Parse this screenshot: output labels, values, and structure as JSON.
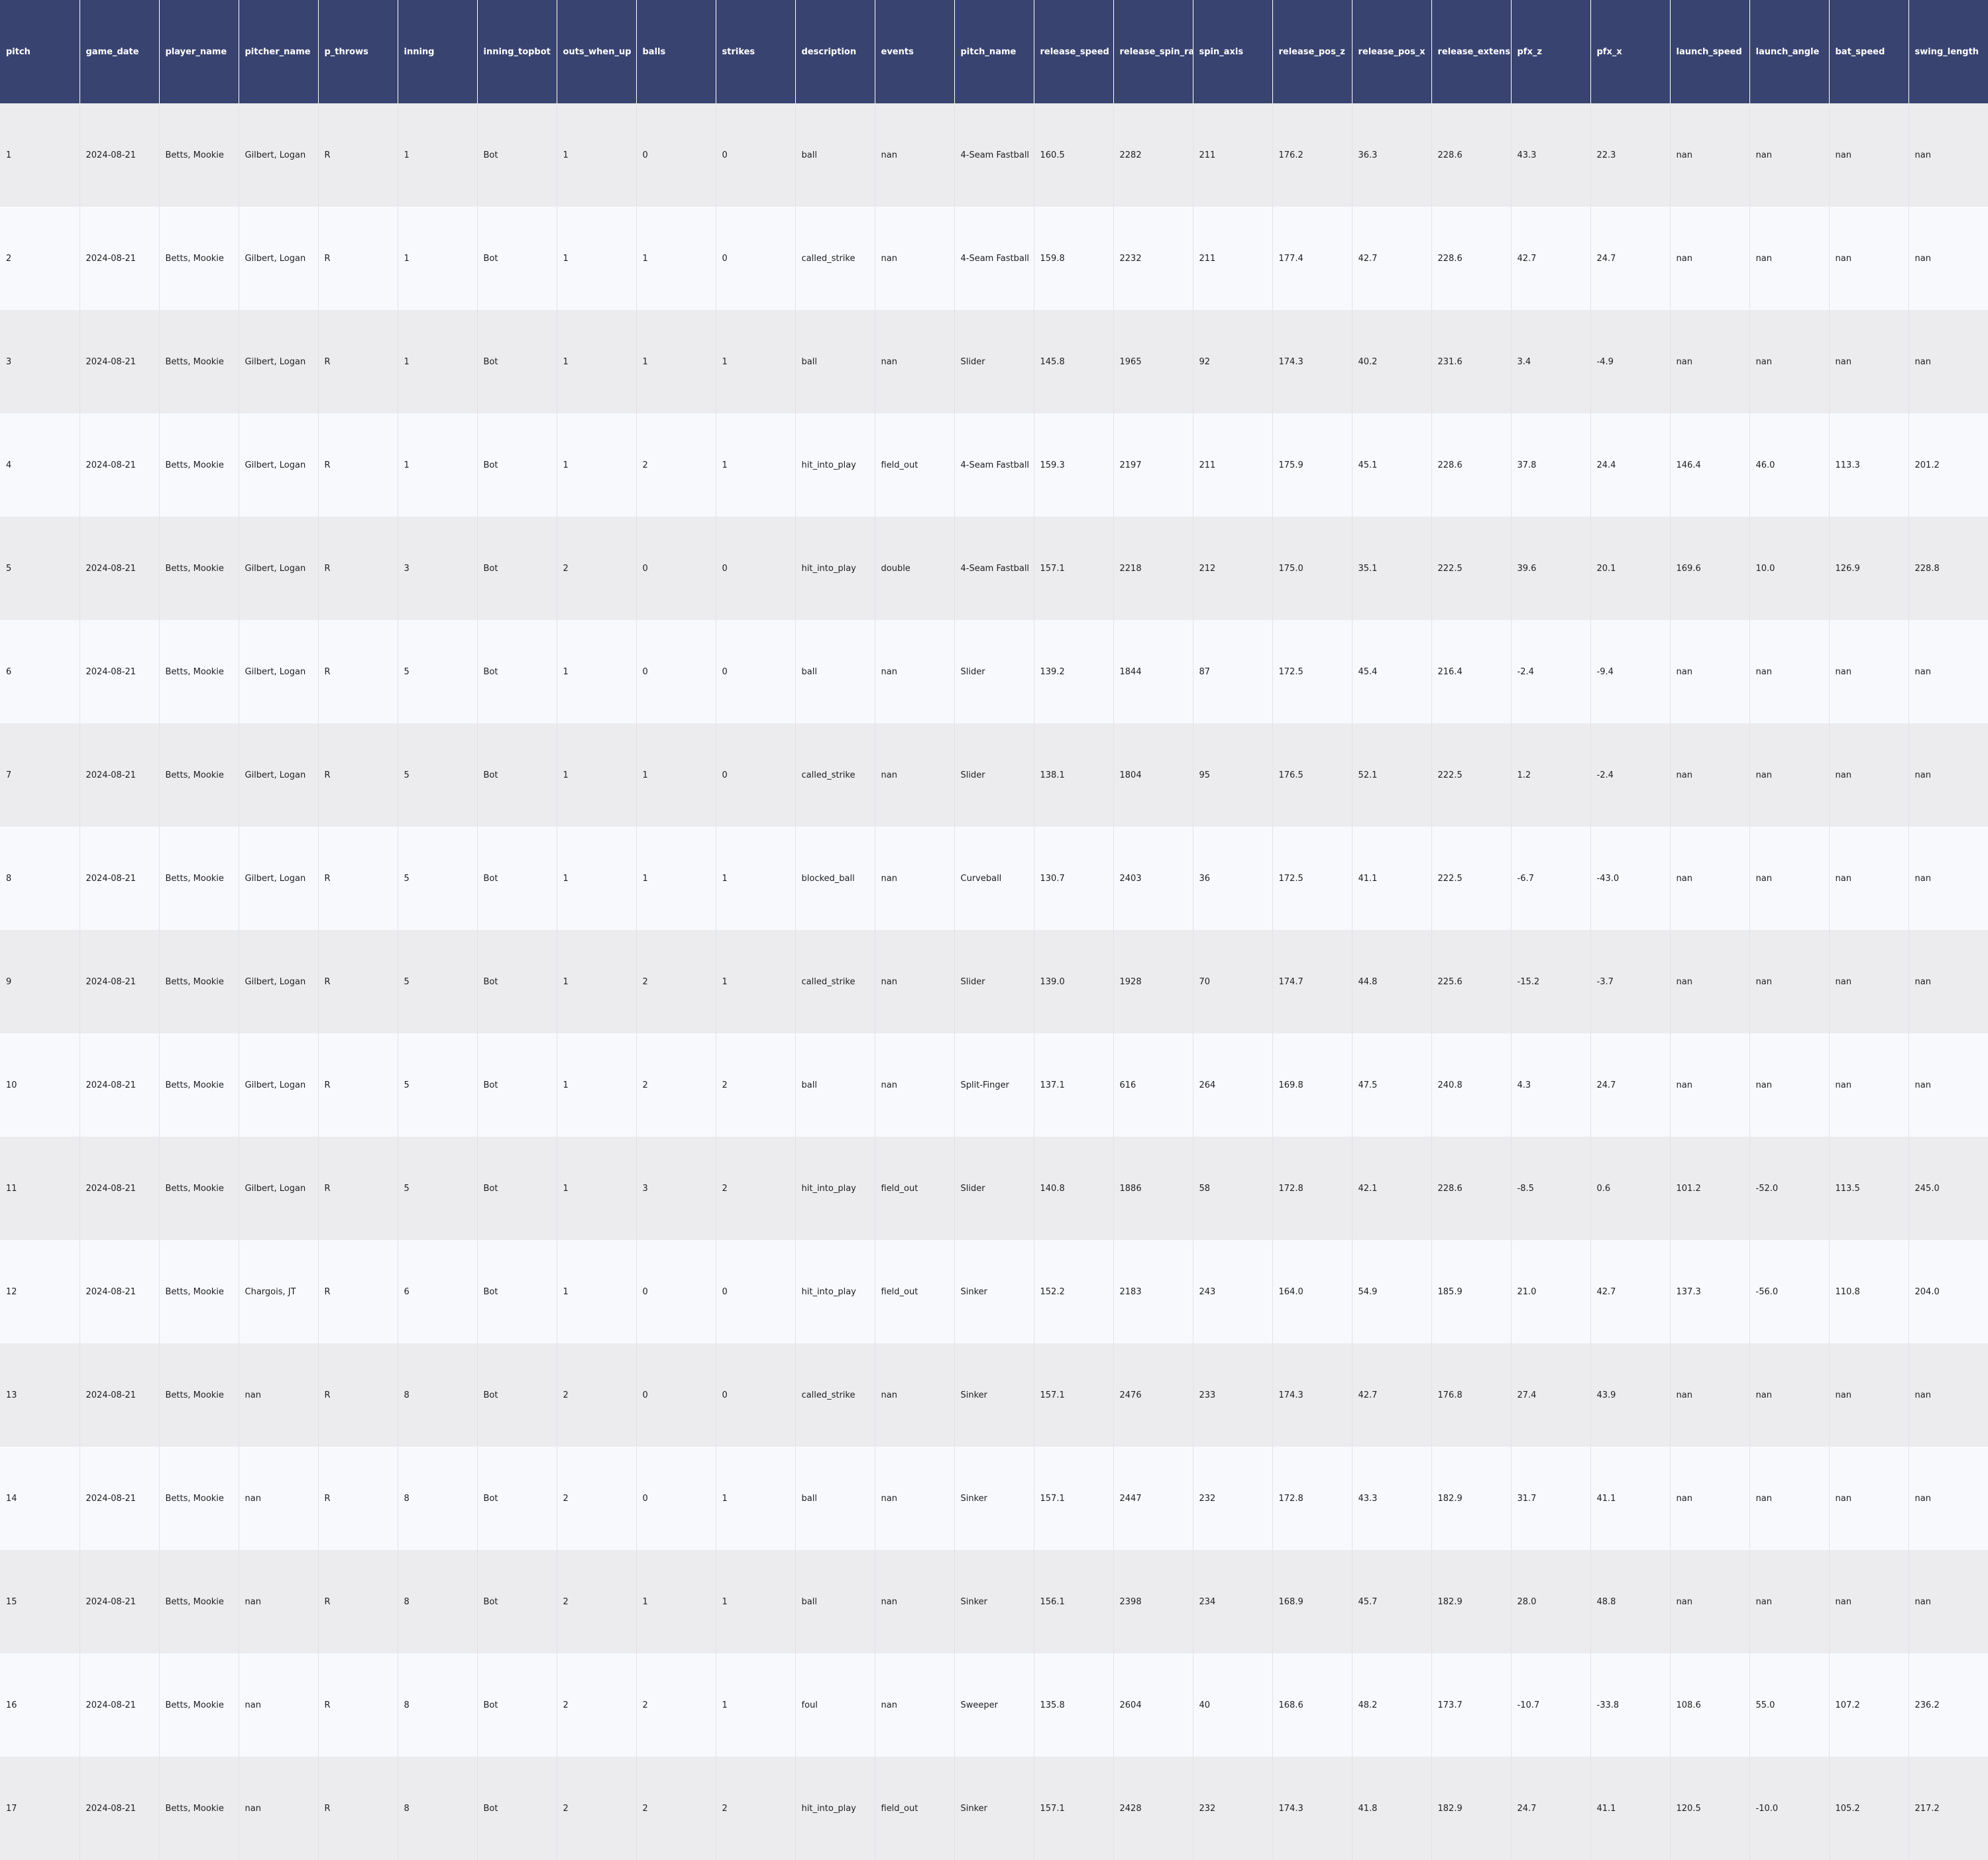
{
  "table": {
    "columns": [
      "pitch",
      "game_date",
      "player_name",
      "pitcher_name",
      "p_throws",
      "inning",
      "inning_topbot",
      "outs_when_up",
      "balls",
      "strikes",
      "description",
      "events",
      "pitch_name",
      "release_speed",
      "release_spin_rate",
      "spin_axis",
      "release_pos_z",
      "release_pos_x",
      "release_extension",
      "pfx_z",
      "pfx_x",
      "launch_speed",
      "launch_angle",
      "bat_speed",
      "swing_length"
    ],
    "rows": [
      [
        "1",
        "2024-08-21",
        "Betts, Mookie",
        "Gilbert, Logan",
        "R",
        "1",
        "Bot",
        "1",
        "0",
        "0",
        "ball",
        "nan",
        "4-Seam Fastball",
        "160.5",
        "2282",
        "211",
        "176.2",
        "36.3",
        "228.6",
        "43.3",
        "22.3",
        "nan",
        "nan",
        "nan",
        "nan"
      ],
      [
        "2",
        "2024-08-21",
        "Betts, Mookie",
        "Gilbert, Logan",
        "R",
        "1",
        "Bot",
        "1",
        "1",
        "0",
        "called_strike",
        "nan",
        "4-Seam Fastball",
        "159.8",
        "2232",
        "211",
        "177.4",
        "42.7",
        "228.6",
        "42.7",
        "24.7",
        "nan",
        "nan",
        "nan",
        "nan"
      ],
      [
        "3",
        "2024-08-21",
        "Betts, Mookie",
        "Gilbert, Logan",
        "R",
        "1",
        "Bot",
        "1",
        "1",
        "1",
        "ball",
        "nan",
        "Slider",
        "145.8",
        "1965",
        "92",
        "174.3",
        "40.2",
        "231.6",
        "3.4",
        "-4.9",
        "nan",
        "nan",
        "nan",
        "nan"
      ],
      [
        "4",
        "2024-08-21",
        "Betts, Mookie",
        "Gilbert, Logan",
        "R",
        "1",
        "Bot",
        "1",
        "2",
        "1",
        "hit_into_play",
        "field_out",
        "4-Seam Fastball",
        "159.3",
        "2197",
        "211",
        "175.9",
        "45.1",
        "228.6",
        "37.8",
        "24.4",
        "146.4",
        "46.0",
        "113.3",
        "201.2"
      ],
      [
        "5",
        "2024-08-21",
        "Betts, Mookie",
        "Gilbert, Logan",
        "R",
        "3",
        "Bot",
        "2",
        "0",
        "0",
        "hit_into_play",
        "double",
        "4-Seam Fastball",
        "157.1",
        "2218",
        "212",
        "175.0",
        "35.1",
        "222.5",
        "39.6",
        "20.1",
        "169.6",
        "10.0",
        "126.9",
        "228.8"
      ],
      [
        "6",
        "2024-08-21",
        "Betts, Mookie",
        "Gilbert, Logan",
        "R",
        "5",
        "Bot",
        "1",
        "0",
        "0",
        "ball",
        "nan",
        "Slider",
        "139.2",
        "1844",
        "87",
        "172.5",
        "45.4",
        "216.4",
        "-2.4",
        "-9.4",
        "nan",
        "nan",
        "nan",
        "nan"
      ],
      [
        "7",
        "2024-08-21",
        "Betts, Mookie",
        "Gilbert, Logan",
        "R",
        "5",
        "Bot",
        "1",
        "1",
        "0",
        "called_strike",
        "nan",
        "Slider",
        "138.1",
        "1804",
        "95",
        "176.5",
        "52.1",
        "222.5",
        "1.2",
        "-2.4",
        "nan",
        "nan",
        "nan",
        "nan"
      ],
      [
        "8",
        "2024-08-21",
        "Betts, Mookie",
        "Gilbert, Logan",
        "R",
        "5",
        "Bot",
        "1",
        "1",
        "1",
        "blocked_ball",
        "nan",
        "Curveball",
        "130.7",
        "2403",
        "36",
        "172.5",
        "41.1",
        "222.5",
        "-6.7",
        "-43.0",
        "nan",
        "nan",
        "nan",
        "nan"
      ],
      [
        "9",
        "2024-08-21",
        "Betts, Mookie",
        "Gilbert, Logan",
        "R",
        "5",
        "Bot",
        "1",
        "2",
        "1",
        "called_strike",
        "nan",
        "Slider",
        "139.0",
        "1928",
        "70",
        "174.7",
        "44.8",
        "225.6",
        "-15.2",
        "-3.7",
        "nan",
        "nan",
        "nan",
        "nan"
      ],
      [
        "10",
        "2024-08-21",
        "Betts, Mookie",
        "Gilbert, Logan",
        "R",
        "5",
        "Bot",
        "1",
        "2",
        "2",
        "ball",
        "nan",
        "Split-Finger",
        "137.1",
        "616",
        "264",
        "169.8",
        "47.5",
        "240.8",
        "4.3",
        "24.7",
        "nan",
        "nan",
        "nan",
        "nan"
      ],
      [
        "11",
        "2024-08-21",
        "Betts, Mookie",
        "Gilbert, Logan",
        "R",
        "5",
        "Bot",
        "1",
        "3",
        "2",
        "hit_into_play",
        "field_out",
        "Slider",
        "140.8",
        "1886",
        "58",
        "172.8",
        "42.1",
        "228.6",
        "-8.5",
        "0.6",
        "101.2",
        "-52.0",
        "113.5",
        "245.0"
      ],
      [
        "12",
        "2024-08-21",
        "Betts, Mookie",
        "Chargois, JT",
        "R",
        "6",
        "Bot",
        "1",
        "0",
        "0",
        "hit_into_play",
        "field_out",
        "Sinker",
        "152.2",
        "2183",
        "243",
        "164.0",
        "54.9",
        "185.9",
        "21.0",
        "42.7",
        "137.3",
        "-56.0",
        "110.8",
        "204.0"
      ],
      [
        "13",
        "2024-08-21",
        "Betts, Mookie",
        "nan",
        "R",
        "8",
        "Bot",
        "2",
        "0",
        "0",
        "called_strike",
        "nan",
        "Sinker",
        "157.1",
        "2476",
        "233",
        "174.3",
        "42.7",
        "176.8",
        "27.4",
        "43.9",
        "nan",
        "nan",
        "nan",
        "nan"
      ],
      [
        "14",
        "2024-08-21",
        "Betts, Mookie",
        "nan",
        "R",
        "8",
        "Bot",
        "2",
        "0",
        "1",
        "ball",
        "nan",
        "Sinker",
        "157.1",
        "2447",
        "232",
        "172.8",
        "43.3",
        "182.9",
        "31.7",
        "41.1",
        "nan",
        "nan",
        "nan",
        "nan"
      ],
      [
        "15",
        "2024-08-21",
        "Betts, Mookie",
        "nan",
        "R",
        "8",
        "Bot",
        "2",
        "1",
        "1",
        "ball",
        "nan",
        "Sinker",
        "156.1",
        "2398",
        "234",
        "168.9",
        "45.7",
        "182.9",
        "28.0",
        "48.8",
        "nan",
        "nan",
        "nan",
        "nan"
      ],
      [
        "16",
        "2024-08-21",
        "Betts, Mookie",
        "nan",
        "R",
        "8",
        "Bot",
        "2",
        "2",
        "1",
        "foul",
        "nan",
        "Sweeper",
        "135.8",
        "2604",
        "40",
        "168.6",
        "48.2",
        "173.7",
        "-10.7",
        "-33.8",
        "108.6",
        "55.0",
        "107.2",
        "236.2"
      ],
      [
        "17",
        "2024-08-21",
        "Betts, Mookie",
        "nan",
        "R",
        "8",
        "Bot",
        "2",
        "2",
        "2",
        "hit_into_play",
        "field_out",
        "Sinker",
        "157.1",
        "2428",
        "232",
        "174.3",
        "41.8",
        "182.9",
        "24.7",
        "41.1",
        "120.5",
        "-10.0",
        "105.2",
        "217.2"
      ]
    ]
  },
  "colors": {
    "header_bg": "#394370",
    "header_text": "#ffffff",
    "row_odd": "#ececef",
    "row_even": "#f8f9fd",
    "cell_text": "#1e1e1e"
  }
}
